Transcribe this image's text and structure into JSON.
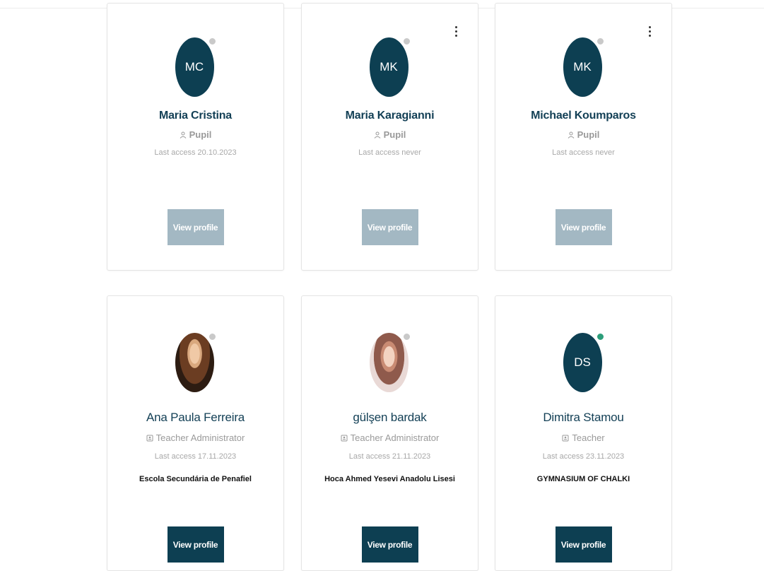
{
  "header": {
    "crumb": ""
  },
  "cards": [
    {
      "initials": "MC",
      "avatar_type": "initials",
      "status": "offline",
      "name": "Maria Cristina",
      "role": "Pupil",
      "role_icon": "user-icon",
      "last_access": "Last access 20.10.2023",
      "school": "",
      "has_menu": false,
      "button_label": "View profile"
    },
    {
      "initials": "MK",
      "avatar_type": "initials",
      "status": "offline",
      "name": "Maria Karagianni",
      "role": "Pupil",
      "role_icon": "user-icon",
      "last_access": "Last access never",
      "school": "",
      "has_menu": true,
      "button_label": "View profile"
    },
    {
      "initials": "MK",
      "avatar_type": "initials",
      "status": "offline",
      "name": "Michael Koumparos",
      "role": "Pupil",
      "role_icon": "user-icon",
      "last_access": "Last access never",
      "school": "",
      "has_menu": true,
      "button_label": "View profile"
    },
    {
      "initials": "",
      "avatar_type": "photo",
      "status": "offline",
      "name": "Ana Paula Ferreira",
      "role": "Teacher Administrator",
      "role_icon": "id-badge-icon",
      "last_access": "Last access 17.11.2023",
      "school": "Escola Secundária de Penafiel",
      "has_menu": false,
      "button_label": "View profile"
    },
    {
      "initials": "",
      "avatar_type": "photo",
      "status": "offline",
      "name": "gülşen bardak",
      "role": "Teacher Administrator",
      "role_icon": "id-badge-icon",
      "last_access": "Last access 21.11.2023",
      "school": "Hoca Ahmed Yesevi Anadolu Lisesi",
      "has_menu": false,
      "button_label": "View profile"
    },
    {
      "initials": "DS",
      "avatar_type": "initials",
      "status": "online",
      "name": "Dimitra Stamou",
      "role": "Teacher",
      "role_icon": "id-badge-icon",
      "last_access": "Last access 23.11.2023",
      "school": "GYMNASIUM OF CHALKI",
      "has_menu": false,
      "button_label": "View profile"
    }
  ],
  "colors": {
    "avatar_bg": "#0d3f52",
    "name": "#123f55",
    "button_disabled": "#a3b8c3",
    "button_active": "#0d3f52",
    "status_online": "#2c9e7a",
    "status_offline": "#c9c9c9"
  }
}
